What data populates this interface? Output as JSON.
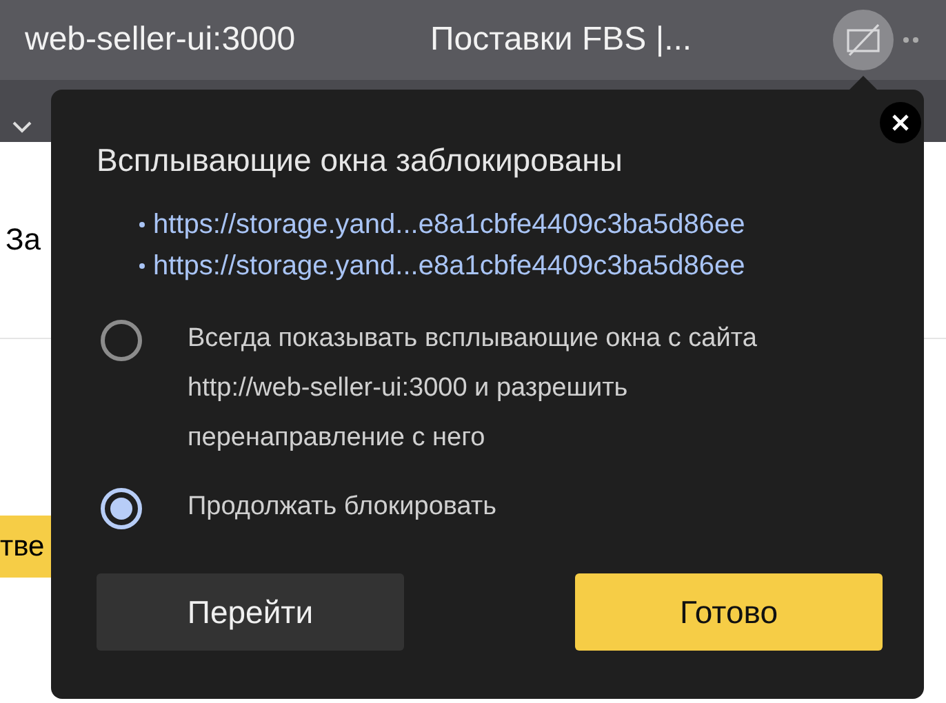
{
  "browser_tab": {
    "host": "web-seller-ui:3000",
    "title": "Поставки FBS |..."
  },
  "page": {
    "heading_fragment": "За",
    "button_fragment": "тве"
  },
  "popup": {
    "title": "Всплывающие окна заблокированы",
    "links": [
      "https://storage.yand...e8a1cbfe4409c3ba5d86ee",
      "https://storage.yand...e8a1cbfe4409c3ba5d86ee"
    ],
    "options": [
      {
        "label": "Всегда показывать всплывающие окна с сайта http://web-seller-ui:3000 и разрешить перенаправление с него",
        "selected": false
      },
      {
        "label": "Продолжать блокировать",
        "selected": true
      }
    ],
    "buttons": [
      {
        "label": "Перейти",
        "kind": "secondary"
      },
      {
        "label": "Готово",
        "kind": "primary"
      }
    ]
  }
}
